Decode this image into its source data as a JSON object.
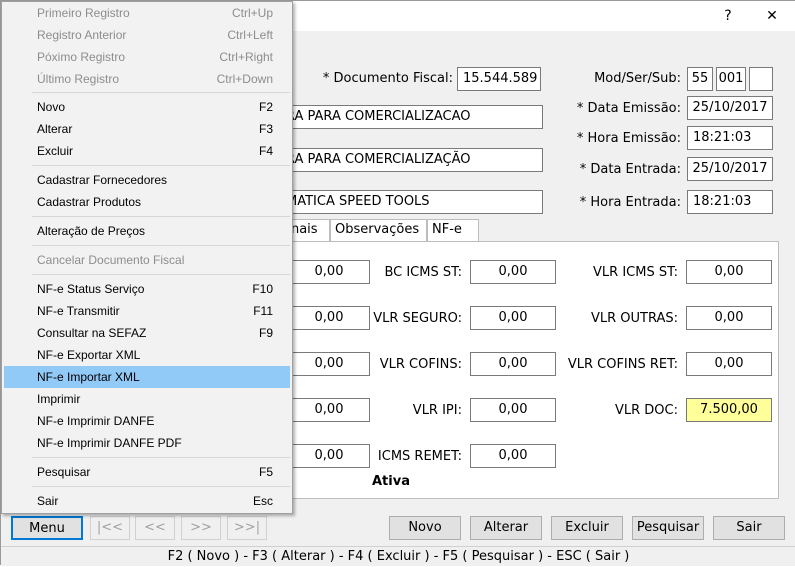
{
  "titlebar": {
    "help": "?",
    "close": "✕"
  },
  "header": {
    "doc_fiscal_label": "* Documento Fiscal:",
    "doc_fiscal_value": "15.544.589",
    "modsersub_label": "Mod/Ser/Sub:",
    "mod": "55",
    "ser": "001",
    "sub": "",
    "natureza1": "RA PARA COMERCIALIZACAO",
    "natureza2": "RA PARA COMERCIALIZAÇÃO",
    "fornecedor": "MATICA SPEED TOOLS",
    "data_emissao_label": "* Data Emissão:",
    "data_emissao": "25/10/2017",
    "hora_emissao_label": "* Hora Emissão:",
    "hora_emissao": "18:21:03",
    "data_entrada_label": "* Data Entrada:",
    "data_entrada": "25/10/2017",
    "hora_entrada_label": "* Hora Entrada:",
    "hora_entrada": "18:21:03"
  },
  "tabs": [
    "onais",
    "Observações",
    "NF-e"
  ],
  "panel": {
    "col1": [
      "0,00",
      "0,00",
      "0,00",
      "0,00",
      "0,00"
    ],
    "bc_icms_st_label": "BC ICMS ST:",
    "bc_icms_st": "0,00",
    "vlr_seguro_label": "VLR SEGURO:",
    "vlr_seguro": "0,00",
    "vlr_cofins_label": "VLR COFINS:",
    "vlr_cofins": "0,00",
    "vlr_ipi_label": "VLR IPI:",
    "vlr_ipi": "0,00",
    "icms_remet_label": "ICMS REMET:",
    "icms_remet": "0,00",
    "vlr_icms_st_label": "VLR ICMS ST:",
    "vlr_icms_st": "0,00",
    "vlr_outras_label": "VLR OUTRAS:",
    "vlr_outras": "0,00",
    "vlr_cofins_ret_label": "VLR COFINS RET:",
    "vlr_cofins_ret": "0,00",
    "vlr_doc_label": "VLR DOC:",
    "vlr_doc": "7.500,00",
    "status": "Ativa"
  },
  "buttons": {
    "menu": "Menu",
    "first": "|<<",
    "prev": "<<",
    "next": ">>",
    "last": ">>|",
    "novo": "Novo",
    "alterar": "Alterar",
    "excluir": "Excluir",
    "pesquisar": "Pesquisar",
    "sair": "Sair"
  },
  "status_bar": "F2 ( Novo )  -  F3 ( Alterar )  -  F4 ( Excluir )  -  F5 ( Pesquisar )  -  ESC ( Sair )",
  "menu": {
    "items": [
      {
        "label": "Primeiro Registro",
        "shortcut": "Ctrl+Up",
        "disabled": true
      },
      {
        "label": "Registro Anterior",
        "shortcut": "Ctrl+Left",
        "disabled": true
      },
      {
        "label": "Póximo Registro",
        "shortcut": "Ctrl+Right",
        "disabled": true
      },
      {
        "label": "Último Registro",
        "shortcut": "Ctrl+Down",
        "disabled": true
      },
      {
        "label": "Novo",
        "shortcut": "F2"
      },
      {
        "label": "Alterar",
        "shortcut": "F3"
      },
      {
        "label": "Excluir",
        "shortcut": "F4"
      },
      {
        "label": "Cadastrar Fornecedores",
        "shortcut": ""
      },
      {
        "label": "Cadastrar Produtos",
        "shortcut": ""
      },
      {
        "label": "Alteração de Preços",
        "shortcut": ""
      },
      {
        "label": "Cancelar Documento Fiscal",
        "shortcut": "",
        "disabled": true
      },
      {
        "label": "NF-e Status Serviço",
        "shortcut": "F10"
      },
      {
        "label": "NF-e Transmitir",
        "shortcut": "F11"
      },
      {
        "label": "Consultar na SEFAZ",
        "shortcut": "F9"
      },
      {
        "label": "NF-e Exportar XML",
        "shortcut": ""
      },
      {
        "label": "NF-e Importar XML",
        "shortcut": "",
        "highlighted": true
      },
      {
        "label": "Imprimir",
        "shortcut": ""
      },
      {
        "label": "NF-e Imprimir DANFE",
        "shortcut": ""
      },
      {
        "label": "NF-e Imprimir DANFE PDF",
        "shortcut": ""
      },
      {
        "label": "Pesquisar",
        "shortcut": "F5"
      },
      {
        "label": "Sair",
        "shortcut": "Esc"
      }
    ]
  },
  "colors": {
    "highlight": "#91c9f7",
    "vlr_doc_bg": "#ffff99",
    "primary_border": "#0078d7"
  }
}
